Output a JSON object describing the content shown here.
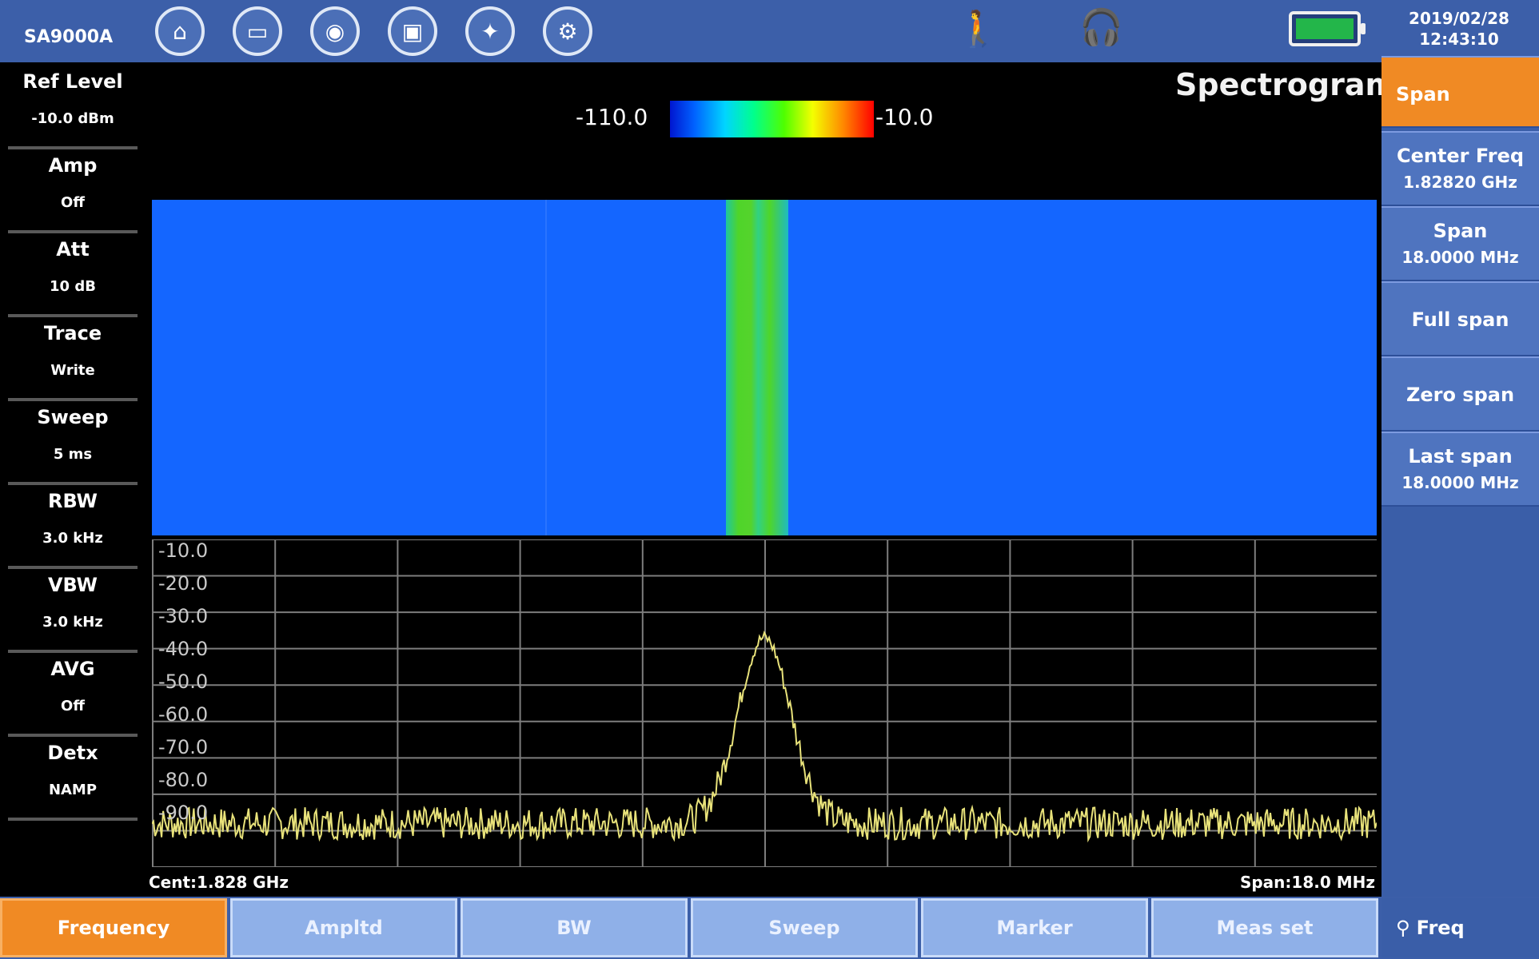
{
  "header": {
    "model": "SA9000A",
    "icons": [
      "home-icon",
      "folder-icon",
      "camera-icon",
      "save-icon",
      "bulb-icon",
      "settings-icon"
    ],
    "datetime_line1": "2019/02/28",
    "datetime_line2": "12:43:10",
    "battery_color": "#23b64a"
  },
  "left_panel": {
    "items": [
      {
        "title": "Ref Level",
        "value": "-10.0 dBm"
      },
      {
        "title": "Amp",
        "value": "Off"
      },
      {
        "title": "Att",
        "value": "10 dB"
      },
      {
        "title": "Trace",
        "value": "Write"
      },
      {
        "title": "Sweep",
        "value": "5 ms"
      },
      {
        "title": "RBW",
        "value": "3.0 kHz"
      },
      {
        "title": "VBW",
        "value": "3.0 kHz"
      },
      {
        "title": "AVG",
        "value": "Off"
      },
      {
        "title": "Detx",
        "value": "NAMP"
      }
    ]
  },
  "display": {
    "title": "Spectrogram",
    "colorbar_min": "-110.0",
    "colorbar_max": "-10.0",
    "center_label": "Cent:1.828 GHz",
    "span_label": "Span:18.0 MHz"
  },
  "chart_data": {
    "type": "line",
    "y_ticks": [
      "-10.0",
      "-20.0",
      "-30.0",
      "-40.0",
      "-50.0",
      "-60.0",
      "-70.0",
      "-80.0",
      "-90.0"
    ],
    "ylim": [
      -100,
      -10
    ],
    "xlim": [
      -9,
      9
    ],
    "x_unit": "MHz offset from center",
    "noise_floor": -88,
    "peak_center": 0,
    "peak_value": -37,
    "peak_halfwidth": 0.55
  },
  "right_panel": {
    "items": [
      {
        "label": "Span",
        "active": true
      },
      {
        "label": "Center Freq",
        "value": "1.82820 GHz"
      },
      {
        "label": "Span",
        "value": "18.0000 MHz"
      },
      {
        "label": "Full span"
      },
      {
        "label": "Zero span"
      },
      {
        "label": "Last span",
        "value": "18.0000 MHz"
      }
    ]
  },
  "bottom_tabs": [
    "Frequency",
    "Ampltd",
    "BW",
    "Sweep",
    "Marker",
    "Meas set"
  ],
  "bottom_active": "Frequency",
  "bottom_right": "Freq"
}
